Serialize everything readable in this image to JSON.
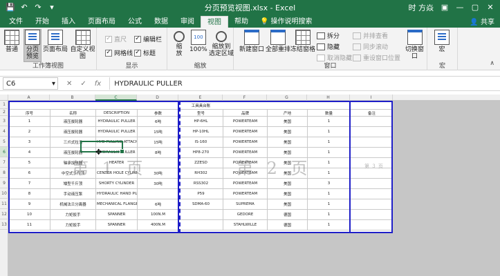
{
  "titlebar": {
    "title": "分页预览视图.xlsx - Excel",
    "user": "时 方焱",
    "qa_save": "💾",
    "qa_undo": "↶",
    "qa_redo": "↷",
    "qa_more": "▾",
    "help": "?",
    "min": "—",
    "max": "▢",
    "close": "✕",
    "ribbon_toggle": "▣"
  },
  "tabs": [
    "文件",
    "开始",
    "插入",
    "页面布局",
    "公式",
    "数据",
    "审阅",
    "视图",
    "帮助"
  ],
  "active_tab": "视图",
  "search": {
    "icon": "lightbulb-icon",
    "label": "操作说明搜索"
  },
  "share": "共享",
  "ribbon": {
    "workbook_views": {
      "label": "工作簿视图",
      "normal": "普通",
      "pagebreak": "分页\n预览",
      "pagelayout": "页面布局",
      "custom": "自定义视图"
    },
    "show": {
      "label": "显示",
      "ruler": "直尺",
      "formula_bar": "编辑栏",
      "gridlines": "网格线",
      "headings": "标题"
    },
    "zoom": {
      "label": "缩放",
      "zoom": "缩\n放",
      "hundred": "100%",
      "to_selection": "缩放到\n选定区域"
    },
    "window": {
      "label": "窗口",
      "new_window": "新建窗口",
      "arrange_all": "全部重排",
      "freeze": "冻结窗格",
      "split": "拆分",
      "hide": "隐藏",
      "unhide": "取消隐藏",
      "side_by_side": "并排查看",
      "sync_scroll": "同步滚动",
      "reset_pos": "重设窗口位置",
      "switch": "切换窗口"
    },
    "macros": {
      "label": "宏",
      "macro": "宏"
    }
  },
  "formula_bar": {
    "name_box": "C6",
    "cancel": "✕",
    "enter": "✓",
    "fx": "fx",
    "value": "HYDRAULIC PULLER"
  },
  "columns": [
    "A",
    "B",
    "C",
    "D",
    "E",
    "F",
    "G",
    "H",
    "I"
  ],
  "rows": [
    "1",
    "2",
    "3",
    "4",
    "5",
    "6",
    "7",
    "8",
    "9",
    "10",
    "11",
    "12",
    "13"
  ],
  "sheet": {
    "title": "工具具台账",
    "headers": [
      "序号",
      "名称",
      "DESCRIPTION",
      "参数",
      "型号",
      "品牌",
      "产地",
      "数量",
      "备注"
    ],
    "data": [
      [
        "1",
        "液压拔轮器",
        "HYDRAULIC PULLER",
        "6吨",
        "HP-6HL",
        "POWERTEAM",
        "美国",
        "1",
        ""
      ],
      [
        "2",
        "液压拔轮器",
        "HYDRAULIC PULLER",
        "15吨",
        "HP-10HL",
        "POWERTEAM",
        "美国",
        "1",
        ""
      ],
      [
        "3",
        "三爪式拉马",
        "HYD PULLING ATTACH",
        "15吨",
        "IS-160",
        "POWERTEAM",
        "美国",
        "1",
        ""
      ],
      [
        "4",
        "液压拔轮器",
        "HYDRAULIC PULLER",
        "8吨",
        "HP8-270",
        "POWERTEAM",
        "美国",
        "1",
        ""
      ],
      [
        "5",
        "轴承加热器",
        "HEATER",
        "",
        "ZZESD",
        "POWERTEAM",
        "美国",
        "1",
        ""
      ],
      [
        "6",
        "中空式千斤顶",
        "CENTER HOLE CYLINDER",
        "30吨",
        "RH302",
        "POWERTEAM",
        "美国",
        "1",
        ""
      ],
      [
        "7",
        "矮型千斤顶",
        "SHORTY CYLINDER",
        "30吨",
        "RSS302",
        "POWERTEAM",
        "美国",
        "3",
        ""
      ],
      [
        "8",
        "手动液压泵",
        "HYDRAULIC HAND PUMP",
        "",
        "P59",
        "POWERTEAM",
        "美国",
        "1",
        ""
      ],
      [
        "9",
        "机械法兰分离器",
        "MECHANICAL FLANGE SPREADER",
        "6吨",
        "SDMA-60",
        "SUPREMA",
        "美国",
        "1",
        ""
      ],
      [
        "10",
        "力矩扳手",
        "SPANNER",
        "100N.M",
        "",
        "GEDORE",
        "德国",
        "1",
        ""
      ],
      [
        "11",
        "力矩扳手",
        "SPANNER",
        "400N.M",
        "",
        "STAHLWILLE",
        "德国",
        "1",
        ""
      ]
    ]
  },
  "watermarks": {
    "page1": "第 1 页",
    "page2": "第 2 页",
    "page3": "第 3 页"
  },
  "colors": {
    "accent": "#217346",
    "page_break": "#1e1ec8"
  }
}
